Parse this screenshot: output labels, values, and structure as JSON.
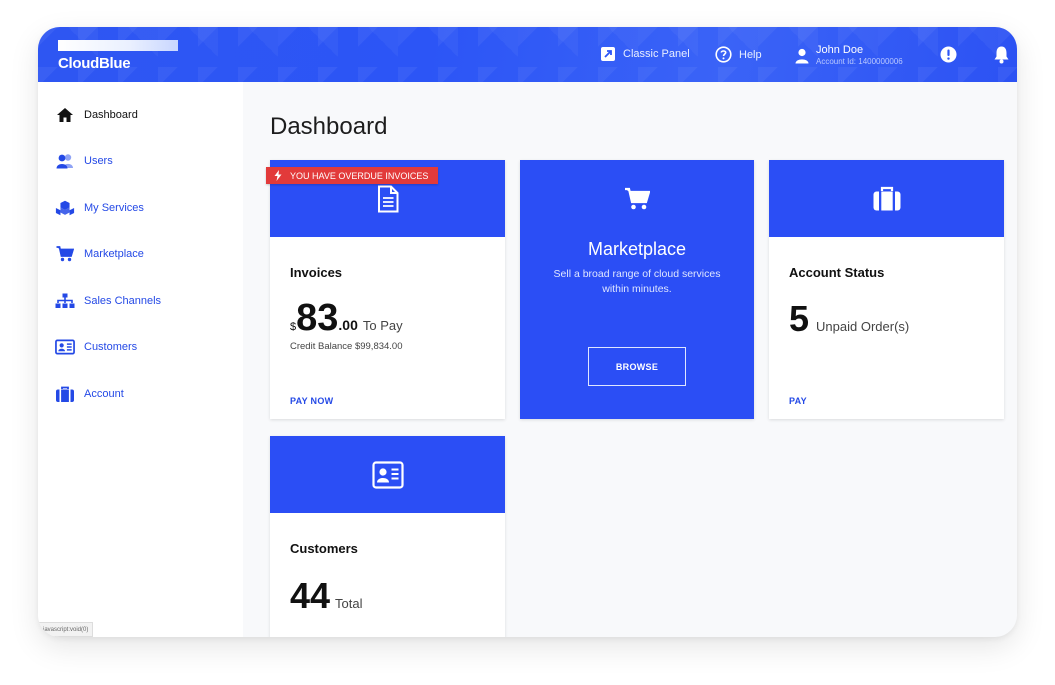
{
  "brand": {
    "logo_text": "CloudBlue"
  },
  "topbar": {
    "classic_panel": "Classic Panel",
    "help": "Help",
    "user_name": "John Doe",
    "account_id": "Account Id: 1400000006"
  },
  "sidebar": {
    "items": [
      {
        "label": "Dashboard",
        "icon": "home-icon"
      },
      {
        "label": "Users",
        "icon": "users-icon"
      },
      {
        "label": "My Services",
        "icon": "cubes-icon"
      },
      {
        "label": "Marketplace",
        "icon": "cart-icon"
      },
      {
        "label": "Sales Channels",
        "icon": "sitemap-icon"
      },
      {
        "label": "Customers",
        "icon": "id-card-icon"
      },
      {
        "label": "Account",
        "icon": "briefcase-icon"
      }
    ]
  },
  "main": {
    "title": "Dashboard",
    "invoices": {
      "badge": "YOU HAVE OVERDUE INVOICES",
      "title": "Invoices",
      "currency": "$",
      "amount_int": "83",
      "amount_dec": ".00",
      "amount_suffix": "To Pay",
      "credit": "Credit Balance $99,834.00",
      "action": "PAY NOW"
    },
    "marketplace": {
      "title": "Marketplace",
      "desc_line1": "Sell a broad range of cloud services",
      "desc_line2": "within minutes.",
      "action": "BROWSE"
    },
    "account_status": {
      "title": "Account Status",
      "count": "5",
      "suffix": "Unpaid Order(s)",
      "action": "PAY"
    },
    "customers": {
      "title": "Customers",
      "count": "44",
      "suffix": "Total"
    }
  },
  "statusbar": {
    "text": "javascript:void(0)"
  },
  "colors": {
    "accent": "#2b4ef5",
    "alert": "#e23a3a"
  }
}
